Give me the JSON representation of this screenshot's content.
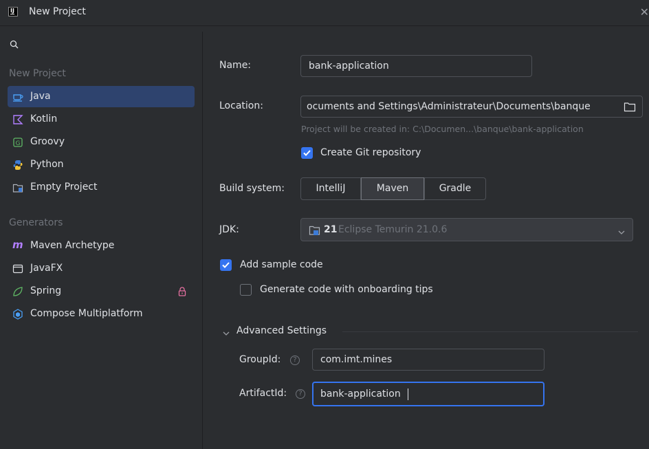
{
  "window": {
    "title": "New Project",
    "close_glyph": "✕"
  },
  "sidebar": {
    "search_icon": "search-icon",
    "section_new_project": "New Project",
    "project_types": [
      {
        "label": "Java",
        "icon": "java-cup-icon",
        "selected": true
      },
      {
        "label": "Kotlin",
        "icon": "kotlin-icon"
      },
      {
        "label": "Groovy",
        "icon": "groovy-icon"
      },
      {
        "label": "Python",
        "icon": "python-icon"
      },
      {
        "label": "Empty Project",
        "icon": "empty-project-icon"
      }
    ],
    "section_generators": "Generators",
    "generators": [
      {
        "label": "Maven Archetype",
        "icon": "maven-icon"
      },
      {
        "label": "JavaFX",
        "icon": "javafx-window-icon"
      },
      {
        "label": "Spring",
        "icon": "spring-leaf-icon",
        "badge_icon": "lock-icon"
      },
      {
        "label": "Compose Multiplatform",
        "icon": "compose-icon"
      }
    ]
  },
  "form": {
    "name_label": "Name:",
    "name_value": "bank-application",
    "location_label": "Location:",
    "location_value": "ocuments and Settings\\Administrateur\\Documents\\banque",
    "location_hint": "Project will be created in: C:\\Documen...\\banque\\bank-application",
    "create_git_label": "Create Git repository",
    "create_git_checked": true,
    "build_system_label": "Build system:",
    "build_systems": [
      "IntelliJ",
      "Maven",
      "Gradle"
    ],
    "build_system_selected": "Maven",
    "jdk_label": "JDK:",
    "jdk_version": "21",
    "jdk_name": "Eclipse Temurin 21.0.6",
    "add_sample_label": "Add sample code",
    "add_sample_checked": true,
    "onboarding_label": "Generate code with onboarding tips",
    "onboarding_checked": false,
    "advanced_label": "Advanced Settings",
    "group_id_label": "GroupId:",
    "group_id_value": "com.imt.mines",
    "artifact_id_label": "ArtifactId:",
    "artifact_id_value": "bank-application"
  },
  "colors": {
    "background": "#2b2d30",
    "selection": "#2e436e",
    "accent": "#3574f0",
    "muted_text": "#6f737a",
    "text": "#dfe1e5"
  }
}
